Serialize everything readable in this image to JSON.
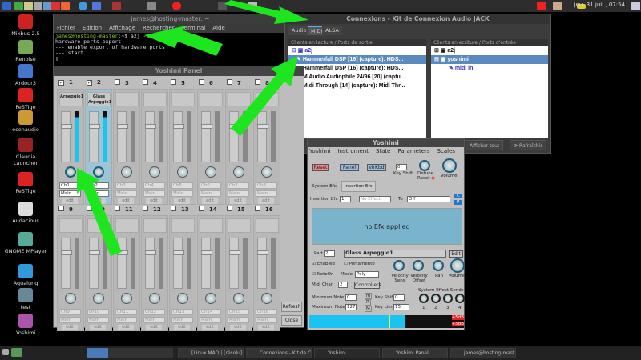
{
  "top_panel": {
    "clock": "jeu. 31 juil., 07:54"
  },
  "desktop_icons": [
    {
      "label": "Mixbus-2.5",
      "color": "#c22"
    },
    {
      "label": "Renoise",
      "color": "#7a5"
    },
    {
      "label": "Ardour3",
      "color": "#47c"
    },
    {
      "label": "FeSTige",
      "color": "#d22"
    },
    {
      "label": "ocenaudio",
      "color": "#c93"
    },
    {
      "label": "Claudia Launcher",
      "color": "#922"
    },
    {
      "label": "FeSTige",
      "color": "#d22"
    },
    {
      "label": "Audacious",
      "color": "#ddd"
    },
    {
      "label": "GNOME MPlayer",
      "color": "#5a9"
    },
    {
      "label": "Aqualung",
      "color": "#39d"
    },
    {
      "label": "test",
      "color": "#689"
    },
    {
      "label": "Yoshimi",
      "color": "#a5a"
    }
  ],
  "terminal": {
    "title": "james@hosting-master: ~",
    "menu": [
      "Fichier",
      "Edition",
      "Affichage",
      "Rechercher",
      "Terminal",
      "Aide"
    ],
    "prompt": "james@hosting-master",
    "command": ":~$ a2j -e",
    "lines": [
      "hardware ports export",
      "--- enable export of hardware ports",
      "--- start"
    ]
  },
  "connexions": {
    "title": "Connexions - Kit de Connexion Audio JACK",
    "tabs": [
      "Audio",
      "MIDI",
      "ALSA"
    ],
    "active_tab": "MIDI",
    "left": {
      "header": "Clients en lecture / Ports de sortie",
      "client": "a2j",
      "ports": [
        "Hammerfall DSP [16] (capture): HDS...",
        "Hammerfall DSP [16] (capture): HDS...",
        "M Audio Audiophile 24/96 [20] (captu...",
        "Midi Through [14] (capture): Midi Thr..."
      ]
    },
    "right": {
      "header": "Clients en ecriture / Ports d'entrée",
      "clients": [
        "a2j",
        "yoshimi"
      ],
      "port": "midi in"
    },
    "buttons": {
      "show_all": "Afficher tout",
      "refresh": "Rafraîchir"
    }
  },
  "yoshimi_panel": {
    "title": "Yoshimi Panel",
    "refresh": "Refresh",
    "close": "Close",
    "edit": "edit",
    "parts": [
      {
        "num": "1",
        "enabled": true,
        "name": "Arpeggio1",
        "chan": "Ch1",
        "out": "Main"
      },
      {
        "num": "2",
        "enabled": true,
        "name": "Glass Arpeggio1",
        "chan": "Ch2",
        "out": "Main",
        "selected": true
      },
      {
        "num": "3",
        "chan": "Ch3",
        "out": "Main"
      },
      {
        "num": "4",
        "chan": "Ch4",
        "out": "Main"
      },
      {
        "num": "5",
        "chan": "Ch5",
        "out": "Main"
      },
      {
        "num": "6",
        "chan": "Ch6",
        "out": "Main"
      },
      {
        "num": "7",
        "chan": "Ch7",
        "out": "Main"
      },
      {
        "num": "8",
        "chan": "Ch8",
        "out": "Main"
      },
      {
        "num": "9",
        "chan": "Ch9",
        "out": "Main"
      },
      {
        "num": "10",
        "chan": "Dr10",
        "out": "Main"
      },
      {
        "num": "11",
        "chan": "Ch11",
        "out": "Main"
      },
      {
        "num": "12",
        "chan": "Ch12",
        "out": "Main"
      },
      {
        "num": "13",
        "chan": "Ch13",
        "out": "Main"
      },
      {
        "num": "14",
        "chan": "Ch14",
        "out": "Main"
      },
      {
        "num": "15",
        "chan": "Ch15",
        "out": "Main"
      },
      {
        "num": "16",
        "chan": "Ch16",
        "out": "Main"
      }
    ]
  },
  "yoshimi": {
    "title": "Yoshimi",
    "menu": [
      "Yoshimi",
      "Instrument",
      "State",
      "Parameters",
      "Scales"
    ],
    "reset": "Reset",
    "panel": "Panel",
    "virkbd": "virKbd",
    "key_shift_label": "Key Shift",
    "key_shift": "0",
    "detune_label": "Detune",
    "detune_reset": "Reset",
    "volume_label": "Volume",
    "efx_tabs": [
      "System Efx",
      "Insertion Efx"
    ],
    "insertion_label": "Insertion Efx",
    "insertion_num": "1",
    "effect": "No Effect",
    "to_label": "To",
    "to": "Off",
    "c": "C",
    "p": "P",
    "no_efx": "no Efx applied",
    "part_label": "Part",
    "part": "2",
    "part_name": "Glass Arpeggio1",
    "edit": "Edit",
    "enabled": "Enabled",
    "portamento": "Portamento",
    "noteon": "NoteOn",
    "mode_label": "Mode",
    "mode": "Poly",
    "midi_chan_label": "Midi Chan",
    "midi_chan": "2",
    "controllers": "Controllers",
    "knobs": [
      "Velocity Sens",
      "Velocity Offset",
      "Pan",
      "Volume"
    ],
    "min_note_label": "Minimum Note",
    "min_note": "0",
    "max_note_label": "Maximum Note",
    "max_note": "127",
    "key_shift2_label": "Key Shift",
    "key_shift2": "0",
    "key_limit_label": "Key Limit",
    "key_limit": "15",
    "m1": "m",
    "r": "R",
    "m2": "M",
    "sends_label": "System Effect Sends",
    "sends": [
      "1",
      "2",
      "3",
      "4"
    ],
    "clip": "+5dB"
  },
  "taskbar": [
    "[Linux MAO | [résolu] ...",
    "Connexions - Kit de C...",
    "Yoshimi",
    "Yoshimi Panel",
    "james@hosting-mast..."
  ],
  "colors": {
    "arrow": "#1ee61e",
    "accent": "#1ac3f0"
  }
}
